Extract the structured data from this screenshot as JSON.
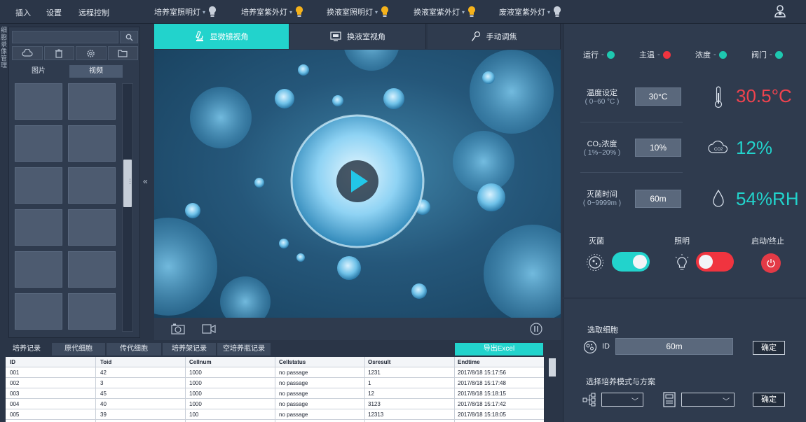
{
  "topbar": {
    "menus": [
      "插入",
      "设置",
      "远程控制"
    ],
    "lamps": [
      {
        "label": "培养室照明灯",
        "color": "#c8cfda"
      },
      {
        "label": "培养室紫外灯",
        "color": "#f5b21b"
      },
      {
        "label": "换液室照明灯",
        "color": "#f5b21b"
      },
      {
        "label": "换液室紫外灯",
        "color": "#f5b21b"
      },
      {
        "label": "废液室紫外灯",
        "color": "#c8cfda"
      }
    ]
  },
  "sidebar": {
    "vertical_tab": "细胞录像管理",
    "media_tabs": [
      "图片",
      "视频"
    ],
    "active_media_tab": "视频"
  },
  "view_tabs": [
    {
      "label": "显微镜视角",
      "icon": "microscope-icon"
    },
    {
      "label": "换液室视角",
      "icon": "monitor-icon"
    },
    {
      "label": "手动调焦",
      "icon": "focus-icon"
    }
  ],
  "records": {
    "tabs": [
      "培养记录",
      "原代细胞",
      "传代细胞",
      "培养架记录",
      "空培养瓶记录"
    ],
    "export_label": "导出Excel",
    "columns": [
      "ID",
      "Toid",
      "Cellnum",
      "Cellstatus",
      "Osresult",
      "Endtime"
    ],
    "rows": [
      [
        "001",
        "42",
        "1000",
        "no passage",
        "1231",
        "2017/8/18 15:17:56"
      ],
      [
        "002",
        "3",
        "1000",
        "no passage",
        "1",
        "2017/8/18 15:17:48"
      ],
      [
        "003",
        "45",
        "1000",
        "no passage",
        "12",
        "2017/8/18 15:18:15"
      ],
      [
        "004",
        "40",
        "1000",
        "no passage",
        "3123",
        "2017/8/18 15:17:42"
      ],
      [
        "005",
        "39",
        "100",
        "no passage",
        "12313",
        "2017/8/18 15:18:05"
      ]
    ]
  },
  "status": [
    {
      "label": "运行",
      "color": "#1ec8b0"
    },
    {
      "label": "主温",
      "color": "#f0343f"
    },
    {
      "label": "浓度",
      "color": "#1ec8b0"
    },
    {
      "label": "阀门",
      "color": "#1ec8b0"
    }
  ],
  "params": {
    "temp": {
      "label": "温度设定",
      "range": "( 0~60 °C )",
      "set": "30°C",
      "reading": "30.5°C",
      "color": "#f0434e"
    },
    "co2": {
      "label": "CO₂浓度",
      "range": "( 1%~20% )",
      "set": "10%",
      "reading": "12%",
      "color": "#22d3cc"
    },
    "time": {
      "label": "灭菌时间",
      "range": "( 0~9999m )",
      "set": "60m",
      "reading": "54%RH",
      "color": "#22d3cc"
    }
  },
  "switches": {
    "sterilize": {
      "label": "灭菌",
      "on": true,
      "color": "#22d3cc"
    },
    "light": {
      "label": "照明",
      "on": false,
      "color": "#f0343f"
    },
    "power": {
      "label": "启动/终止"
    }
  },
  "cell_select": {
    "title": "选取细胞",
    "id_label": "ID",
    "id_value": "60m",
    "ok": "确定"
  },
  "mode_select": {
    "title": "选择培养模式与方案",
    "ok": "确定"
  }
}
